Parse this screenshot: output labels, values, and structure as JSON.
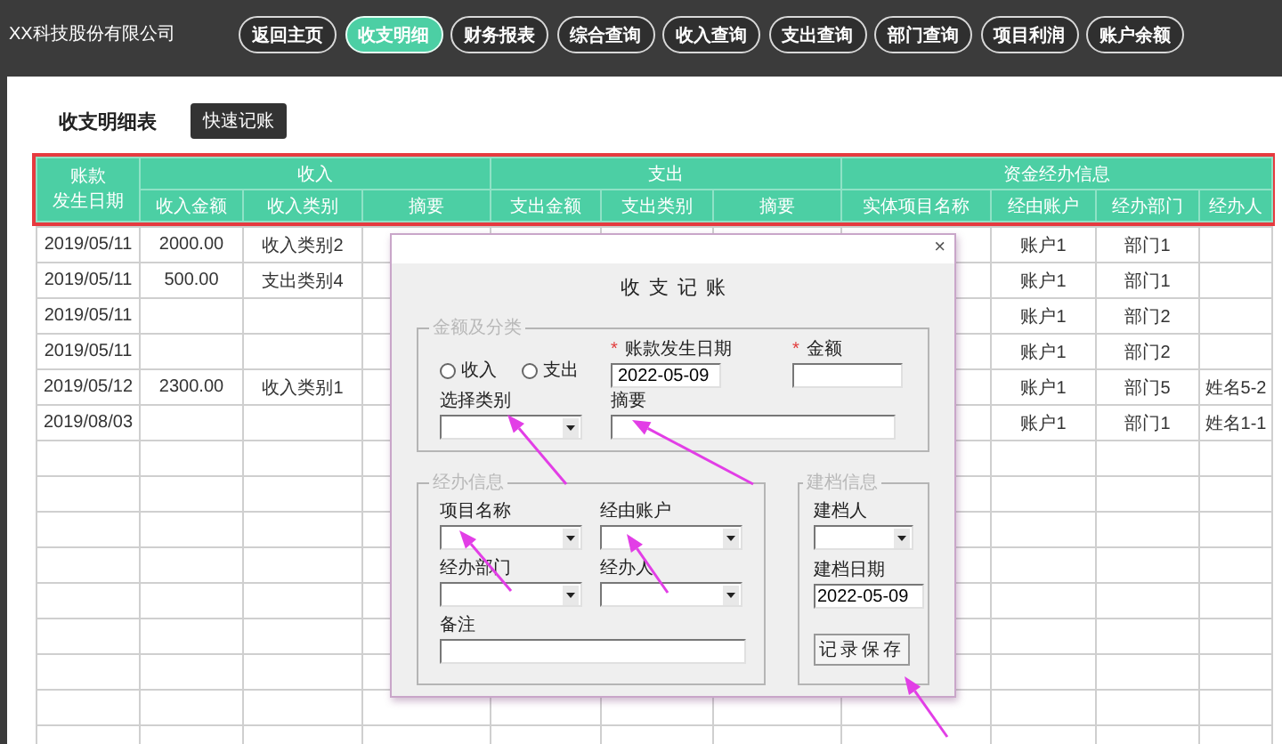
{
  "header": {
    "company": "XX科技股份有限公司",
    "nav": [
      {
        "label": "返回主页",
        "selected": false
      },
      {
        "label": "收支明细",
        "selected": true
      },
      {
        "label": "财务报表",
        "selected": false
      },
      {
        "label": "综合查询",
        "selected": false
      },
      {
        "label": "收入查询",
        "selected": false
      },
      {
        "label": "支出查询",
        "selected": false
      },
      {
        "label": "部门查询",
        "selected": false
      },
      {
        "label": "项目利润",
        "selected": false
      },
      {
        "label": "账户余额",
        "selected": false
      }
    ]
  },
  "page": {
    "title": "收支明细表",
    "quick_button": "快速记账"
  },
  "table": {
    "first_column": [
      "账款",
      "发生日期"
    ],
    "groups": [
      {
        "label": "收入",
        "columns": [
          "收入金额",
          "收入类别",
          "摘要"
        ]
      },
      {
        "label": "支出",
        "columns": [
          "支出金额",
          "支出类别",
          "摘要"
        ]
      },
      {
        "label": "资金经办信息",
        "columns": [
          "实体项目名称",
          "经由账户",
          "经办部门",
          "经办人"
        ]
      }
    ],
    "rows": [
      {
        "date": "2019/05/11",
        "income_amount": "2000.00",
        "income_category": "收入类别2",
        "account": "账户1",
        "department": "部门1"
      },
      {
        "date": "2019/05/11",
        "income_amount": "500.00",
        "income_category": "支出类别4",
        "account": "账户1",
        "department": "部门1"
      },
      {
        "date": "2019/05/11",
        "account": "账户1",
        "department": "部门2"
      },
      {
        "date": "2019/05/11",
        "account": "账户1",
        "department": "部门2"
      },
      {
        "date": "2019/05/12",
        "income_amount": "2300.00",
        "income_category": "收入类别1",
        "account": "账户1",
        "department": "部门5",
        "handler": "姓名5-2"
      },
      {
        "date": "2019/08/03",
        "account": "账户1",
        "department": "部门1",
        "handler": "姓名1-1"
      }
    ]
  },
  "dialog": {
    "close": "×",
    "title": "收支记账",
    "groups": [
      {
        "legend": "金额及分类",
        "radios": [
          {
            "label": "收入",
            "selected": false
          },
          {
            "label": "支出",
            "selected": false
          }
        ],
        "fields": [
          {
            "kind": "text",
            "label": "账款发生日期",
            "required_mark": "*",
            "value": "2022-05-09"
          },
          {
            "kind": "text",
            "label": "金额",
            "required_mark": "*"
          },
          {
            "kind": "combo",
            "label": "选择类别"
          },
          {
            "kind": "text",
            "label": "摘要"
          }
        ]
      },
      {
        "legend": "经办信息",
        "fields": [
          {
            "kind": "combo",
            "label": "项目名称"
          },
          {
            "kind": "combo",
            "label": "经由账户"
          },
          {
            "kind": "combo",
            "label": "经办部门"
          },
          {
            "kind": "combo",
            "label": "经办人"
          },
          {
            "kind": "text",
            "label": "备注"
          }
        ]
      },
      {
        "legend": "建档信息",
        "fields": [
          {
            "kind": "combo",
            "label": "建档人"
          },
          {
            "kind": "text",
            "label": "建档日期",
            "value": "2022-05-09"
          },
          {
            "kind": "button",
            "label": "记录保存"
          }
        ]
      }
    ]
  }
}
